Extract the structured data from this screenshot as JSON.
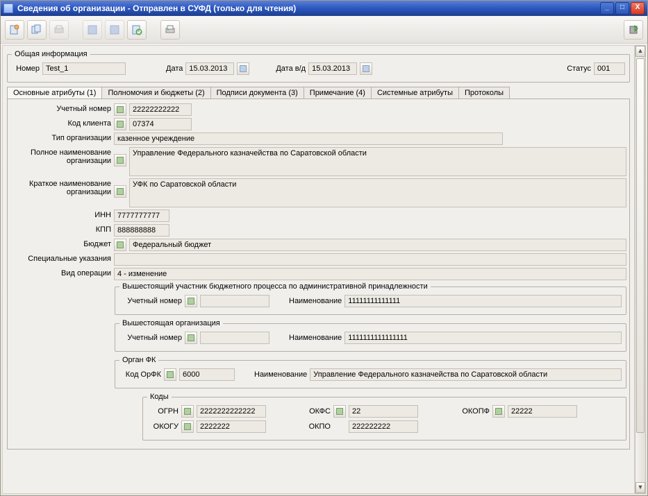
{
  "window": {
    "title": "Сведения об организации - Отправлен в СУФД (только для чтения)",
    "min": "_",
    "max": "□",
    "close": "X"
  },
  "general": {
    "legend": "Общая информация",
    "number_label": "Номер",
    "number": "Test_1",
    "date_label": "Дата",
    "date": "15.03.2013",
    "date_vd_label": "Дата в/д",
    "date_vd": "15.03.2013",
    "status_label": "Статус",
    "status": "001"
  },
  "tabs": [
    "Основные атрибуты (1)",
    "Полномочия и бюджеты (2)",
    "Подписи документа (3)",
    "Примечание (4)",
    "Системные атрибуты",
    "Протоколы"
  ],
  "main": {
    "account_number_label": "Учетный номер",
    "account_number": "22222222222",
    "client_code_label": "Код клиента",
    "client_code": "07374",
    "org_type_label": "Тип организации",
    "org_type": "казенное учреждение",
    "full_name_label": "Полное наименование организации",
    "full_name": "Управление Федерального казначейства по Саратовской области",
    "short_name_label": "Краткое наименование организации",
    "short_name": "УФК по Саратовской области",
    "inn_label": "ИНН",
    "inn": "7777777777",
    "kpp_label": "КПП",
    "kpp": "888888888",
    "budget_label": "Бюджет",
    "budget": "Федеральный бюджет",
    "special_label": "Специальные указания",
    "special": "",
    "op_kind_label": "Вид операции",
    "op_kind": "4 - изменение"
  },
  "superior_budget": {
    "legend": "Вышестоящий участник бюджетного процесса по административной принадлежности",
    "account_number_label": "Учетный номер",
    "account_number": "",
    "name_label": "Наименование",
    "name": "11111111111111"
  },
  "superior_org": {
    "legend": "Вышестоящая организация",
    "account_number_label": "Учетный номер",
    "account_number": "",
    "name_label": "Наименование",
    "name": "1111111111111111"
  },
  "fk": {
    "legend": "Орган ФК",
    "code_label": "Код ОрФК",
    "code": "6000",
    "name_label": "Наименование",
    "name": "Управление Федерального казначейства по Саратовской области"
  },
  "codes": {
    "legend": "Коды",
    "ogrn_label": "ОГРН",
    "ogrn": "2222222222222",
    "okfs_label": "ОКФС",
    "okfs": "22",
    "okopf_label": "ОКОПФ",
    "okopf": "22222",
    "okogu_label": "ОКОГУ",
    "okogu": "2222222",
    "okpo_label": "ОКПО",
    "okpo": "222222222"
  }
}
